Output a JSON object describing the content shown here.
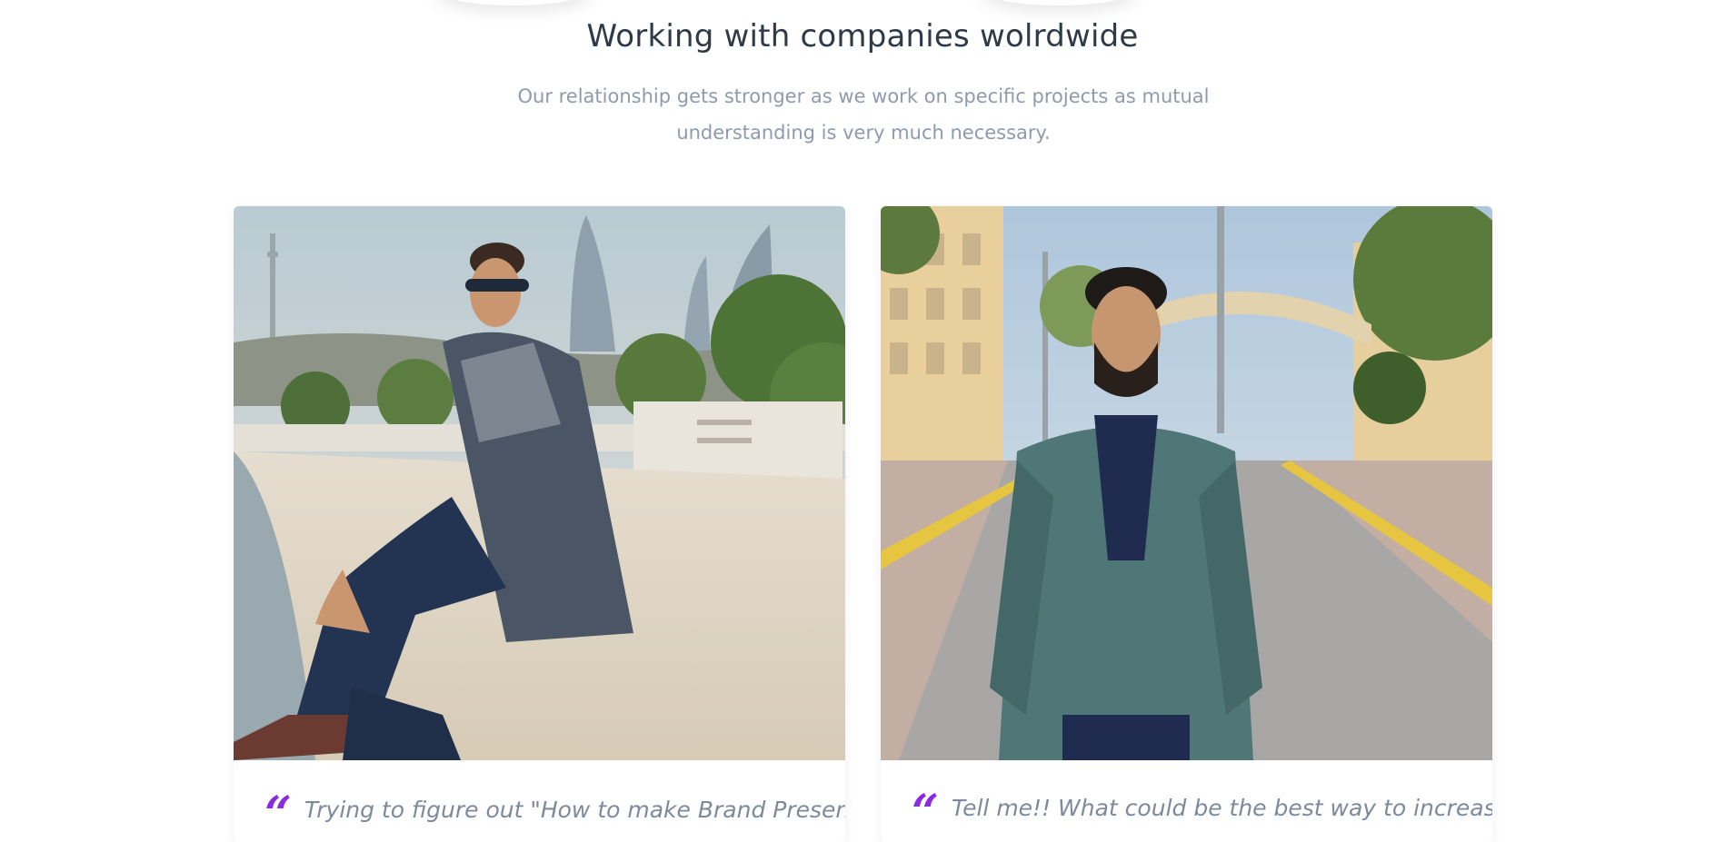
{
  "section": {
    "title": "Working with companies wolrdwide",
    "subtitle_line1": "Our relationship gets stronger as we work on specific projects as mutual",
    "subtitle_line2": "understanding is very much necessary."
  },
  "testimonials": [
    {
      "photo_alt": "Man in checked shirt sitting on a seaside wall",
      "quote_mark": "“",
      "text": "Trying to figure out \"How to make Brand Presence"
    },
    {
      "photo_alt": "Man in teal blazer standing on a street",
      "quote_mark": "“",
      "text": "Tell me!! What could be the best way to increase"
    }
  ],
  "colors": {
    "heading": "#2f3a48",
    "subtitle": "#8e9bad",
    "quote_mark": "#8a2be2",
    "quote_text": "#7d8a9c"
  }
}
